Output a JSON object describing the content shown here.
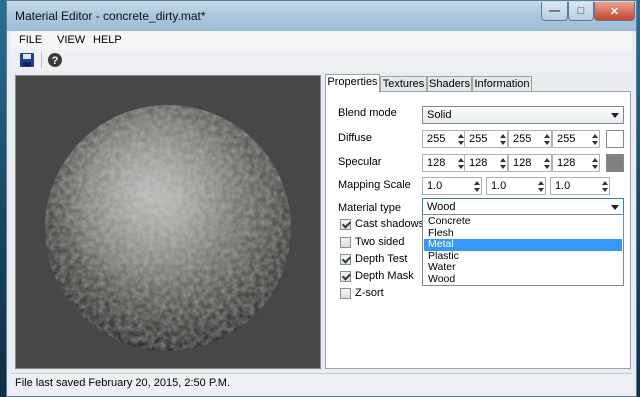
{
  "window": {
    "title": "Material Editor - concrete_dirty.mat*"
  },
  "menu": [
    "FILE",
    "VIEW",
    "HELP"
  ],
  "toolbar": {
    "icons": [
      "save-icon",
      "help-icon"
    ]
  },
  "tabs": [
    "Properties",
    "Textures",
    "Shaders",
    "Information"
  ],
  "active_tab": "Properties",
  "properties": {
    "blend_mode": {
      "label": "Blend mode",
      "value": "Solid"
    },
    "diffuse": {
      "label": "Diffuse",
      "values": [
        "255",
        "255",
        "255",
        "255"
      ],
      "color": "#ffffff"
    },
    "specular": {
      "label": "Specular",
      "values": [
        "128",
        "128",
        "128",
        "128"
      ],
      "color": "#808080"
    },
    "mapping_scale": {
      "label": "Mapping Scale",
      "values": [
        "1.0",
        "1.0",
        "1.0"
      ]
    },
    "material_type": {
      "label": "Material type",
      "value": "Wood",
      "options": [
        "Concrete",
        "Flesh",
        "Metal",
        "Plastic",
        "Water",
        "Wood"
      ],
      "highlighted": "Metal"
    },
    "checkboxes": [
      {
        "label": "Cast shadows",
        "checked": true
      },
      {
        "label": "Two sided",
        "checked": false
      },
      {
        "label": "Depth Test",
        "checked": true
      },
      {
        "label": "Depth Mask",
        "checked": true
      },
      {
        "label": "Z-sort",
        "checked": false
      }
    ]
  },
  "status": "File last saved February 20, 2015, 2:50 P.M.",
  "colors": {
    "selection": "#3399ff",
    "viewport_bg": "#474747"
  }
}
